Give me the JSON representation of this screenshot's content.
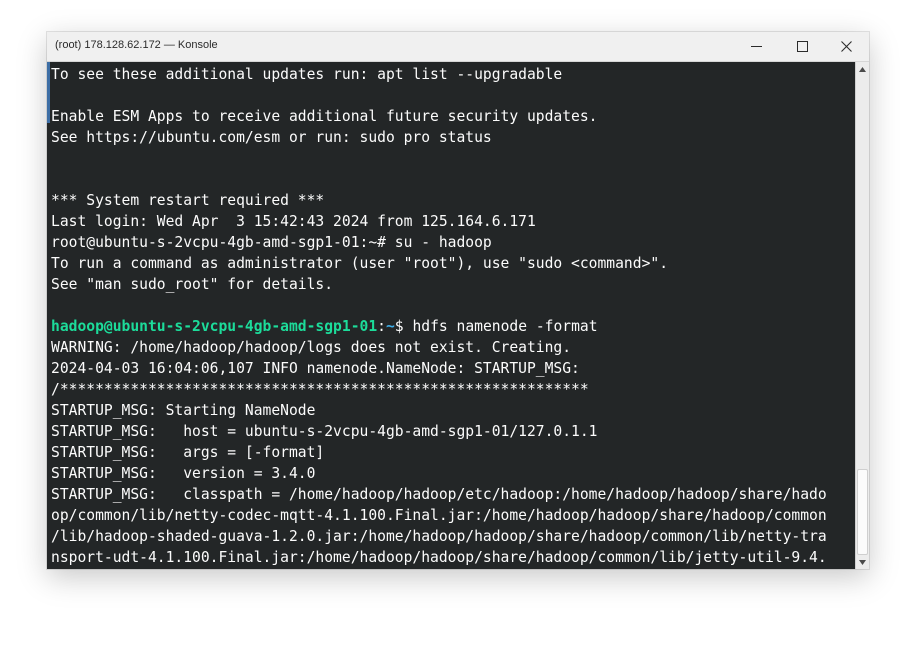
{
  "window": {
    "title": "(root) 178.128.62.172 — Konsole"
  },
  "icons": {
    "minimize": "minimize-icon",
    "maximize": "maximize-icon",
    "close": "close-icon",
    "scroll_up": "triangle-up-icon",
    "scroll_down": "triangle-down-icon"
  },
  "colors": {
    "terminal_bg": "#232627",
    "terminal_fg": "#fcfcfc",
    "prompt_user": "#1cdc9a",
    "prompt_path": "#3daee9"
  },
  "scrollbar": {
    "thumb_start_fraction": 0.82,
    "thumb_size_fraction": 0.18
  },
  "terminal": {
    "lines": [
      {
        "text": "To see these additional updates run: apt list --upgradable"
      },
      {
        "text": ""
      },
      {
        "text": "Enable ESM Apps to receive additional future security updates."
      },
      {
        "text": "See https://ubuntu.com/esm or run: sudo pro status"
      },
      {
        "text": ""
      },
      {
        "text": ""
      },
      {
        "text": "*** System restart required ***"
      },
      {
        "text": "Last login: Wed Apr  3 15:42:43 2024 from 125.164.6.171"
      },
      {
        "text": "root@ubuntu-s-2vcpu-4gb-amd-sgp1-01:~# su - hadoop"
      },
      {
        "text": "To run a command as administrator (user \"root\"), use \"sudo <command>\"."
      },
      {
        "text": "See \"man sudo_root\" for details."
      },
      {
        "text": ""
      },
      {
        "prompt": {
          "user": "hadoop@ubuntu-s-2vcpu-4gb-amd-sgp1-01",
          "sep": ":",
          "path": "~",
          "symbol": "$ ",
          "command": "hdfs namenode -format"
        }
      },
      {
        "text": "WARNING: /home/hadoop/hadoop/logs does not exist. Creating."
      },
      {
        "text": "2024-04-03 16:04:06,107 INFO namenode.NameNode: STARTUP_MSG:"
      },
      {
        "text": "/************************************************************"
      },
      {
        "text": "STARTUP_MSG: Starting NameNode"
      },
      {
        "text": "STARTUP_MSG:   host = ubuntu-s-2vcpu-4gb-amd-sgp1-01/127.0.1.1"
      },
      {
        "text": "STARTUP_MSG:   args = [-format]"
      },
      {
        "text": "STARTUP_MSG:   version = 3.4.0"
      },
      {
        "text": "STARTUP_MSG:   classpath = /home/hadoop/hadoop/etc/hadoop:/home/hadoop/hadoop/share/hado"
      },
      {
        "text": "op/common/lib/netty-codec-mqtt-4.1.100.Final.jar:/home/hadoop/hadoop/share/hadoop/common"
      },
      {
        "text": "/lib/hadoop-shaded-guava-1.2.0.jar:/home/hadoop/hadoop/share/hadoop/common/lib/netty-tra"
      },
      {
        "text": "nsport-udt-4.1.100.Final.jar:/home/hadoop/hadoop/share/hadoop/common/lib/jetty-util-9.4."
      }
    ]
  }
}
